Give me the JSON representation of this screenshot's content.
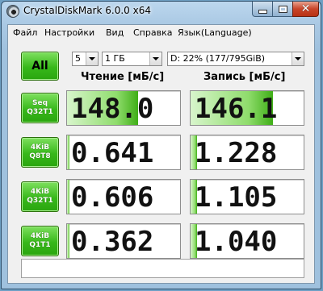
{
  "window": {
    "title": "CrystalDiskMark 6.0.0 x64"
  },
  "menu": [
    "Файл",
    "Настройки",
    "Вид",
    "Справка",
    "Язык(Language)"
  ],
  "controls": {
    "all_label": "All",
    "count": "5",
    "size": "1 ГБ",
    "drive": "D: 22% (177/795GiB)"
  },
  "headers": {
    "read": "Чтение [мБ/с]",
    "write": "Запись [мБ/с]"
  },
  "rows": [
    {
      "l1": "Seq",
      "l2": "Q32T1",
      "read": "148.0",
      "write": "146.1",
      "read_pct": 0.63,
      "write_pct": 0.73
    },
    {
      "l1": "4KiB",
      "l2": "Q8T8",
      "read": "0.641",
      "write": "1.228",
      "read_pct": 0.02,
      "write_pct": 0.06
    },
    {
      "l1": "4KiB",
      "l2": "Q32T1",
      "read": "0.606",
      "write": "1.105",
      "read_pct": 0.02,
      "write_pct": 0.06
    },
    {
      "l1": "4KiB",
      "l2": "Q1T1",
      "read": "0.362",
      "write": "1.040",
      "read_pct": 0.02,
      "write_pct": 0.06
    }
  ],
  "footer": {
    "comment": ""
  },
  "colors": {
    "accent": "#37b81a",
    "titlebar": "#a9c8e3"
  }
}
